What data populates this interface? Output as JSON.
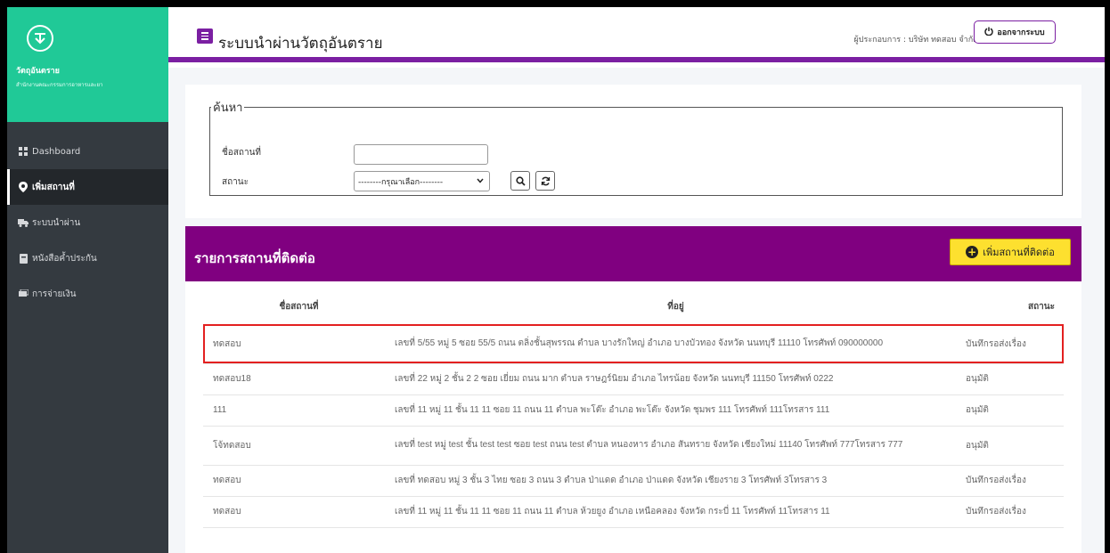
{
  "sidebar": {
    "brand_title": "วัตถุอันตราย",
    "brand_subtitle": "สำนักงานคณะกรรมการอาหารและยา",
    "items": [
      {
        "label": "Dashboard",
        "icon": "grid-icon"
      },
      {
        "label": "เพิ่มสถานที่",
        "icon": "map-pin-icon",
        "active": true
      },
      {
        "label": "ระบบนำผ่าน",
        "icon": "truck-icon"
      },
      {
        "label": "หนังสือค้ำประกัน",
        "icon": "book-icon"
      },
      {
        "label": "การจ่ายเงิน",
        "icon": "money-icon"
      }
    ]
  },
  "topbar": {
    "title": "ระบบนำผ่านวัตถุอันตราย",
    "operator": "ผู้ประกอบการ : บริษัท ทดสอบ จำกัด",
    "logout_label": "ออกจากระบบ"
  },
  "search": {
    "legend": "ค้นหา",
    "name_label": "ชื่อสถานที่",
    "name_value": "",
    "status_label": "สถานะ",
    "status_selected": "--------กรุณาเลือก--------"
  },
  "list": {
    "title": "รายการสถานที่ติดต่อ",
    "add_label": "เพิ่มสถานที่ติดต่อ",
    "columns": [
      "ชื่อสถานที่",
      "ที่อยู่",
      "สถานะ"
    ],
    "rows": [
      {
        "name": "ทดสอบ",
        "address": "เลขที่ 5/55 หมู่ 5 ซอย 55/5 ถนน ตลิ่งชั้นสุพรรณ ตำบล บางรักใหญ่ อำเภอ บางบัวทอง จังหวัด นนทบุรี 11110 โทรศัพท์ 090000000",
        "status": "บันทึกรอส่งเรื่อง"
      },
      {
        "name": "ทดสอบ18",
        "address": "เลขที่ 22 หมู่ 2 ชั้น 2 2 ซอย เยี่ยม ถนน มาก ตำบล ราษฎร์นิยม อำเภอ ไทรน้อย จังหวัด นนทบุรี 11150 โทรศัพท์ 0222",
        "status": "อนุมัติ"
      },
      {
        "name": "111",
        "address": "เลขที่ 11 หมู่ 11 ชั้น 11 11 ซอย 11 ถนน 11 ตำบล พะโต๊ะ อำเภอ พะโต๊ะ จังหวัด ชุมพร 111 โทรศัพท์ 111โทรสาร 111",
        "status": "อนุมัติ"
      },
      {
        "name": "โจ้ทดสอบ",
        "address": "เลขที่ test หมู่ test ชั้น test test ซอย test ถนน test ตำบล หนองหาร อำเภอ สันทราย จังหวัด เชียงใหม่ 11140 โทรศัพท์ 777โทรสาร 777",
        "status": "อนุมัติ"
      },
      {
        "name": "ทดสอบ",
        "address": "เลขที่ ทดสอบ หมู่ 3 ชั้น 3 ไทย ซอย 3 ถนน 3 ตำบล ป่าแดด อำเภอ ป่าแดด จังหวัด เชียงราย 3 โทรศัพท์ 3โทรสาร 3",
        "status": "บันทึกรอส่งเรื่อง"
      },
      {
        "name": "ทดสอบ",
        "address": "เลขที่ 11 หมู่ 11 ชั้น 11 11 ซอย 11 ถนน 11 ตำบล ห้วยยูง อำเภอ เหนือคลอง จังหวัด กระบี่ 11 โทรศัพท์ 11โทรสาร 11",
        "status": "บันทึกรอส่งเรื่อง"
      }
    ]
  },
  "colors": {
    "brand_green": "#20c997",
    "sidebar_dark": "#343a40",
    "accent_purple": "#800080",
    "add_button_yellow": "#fde02f",
    "highlight_red": "#e32020"
  }
}
